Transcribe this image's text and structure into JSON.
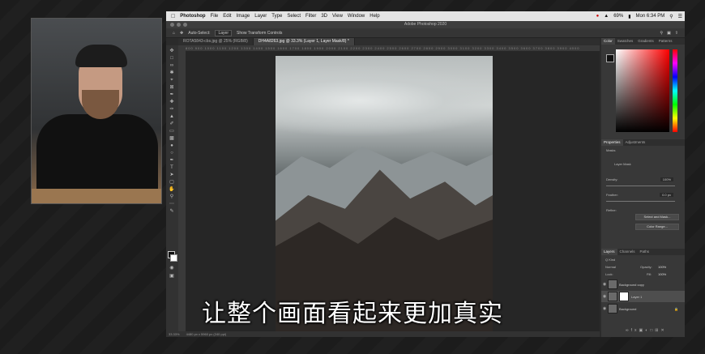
{
  "menubar": {
    "app_name": "Photoshop",
    "items": [
      "File",
      "Edit",
      "Image",
      "Layer",
      "Type",
      "Select",
      "Filter",
      "3D",
      "View",
      "Window",
      "Help"
    ],
    "battery": "69%",
    "clock": "Mon 6:34 PM"
  },
  "window": {
    "title": "Adobe Photoshop 2020"
  },
  "options_bar": {
    "auto_select_label": "Auto-Select:",
    "auto_select_value": "Layer",
    "show_transform": "Show Transform Controls"
  },
  "document_tabs": [
    {
      "label": "ROTA5843-cbs.jpg @ 25% (RGB/8)",
      "active": false
    },
    {
      "label": "DH4A8263.jpg @ 33.3% (Layer 1, Layer Mask/8) *",
      "active": true
    }
  ],
  "ruler_ticks": "800 900 1000 1100 1200 1300 1400 1500 1600 1700 1800 1900 2000 2100 2200 2300 2400 2500 2600 2700 2800 2900 3000 3100 3200 3300 3400 3500 3600 3700 3800 3900 4000",
  "status": {
    "zoom": "33.33%",
    "doc_size": "4480 px x 5960 px (240 ppi)"
  },
  "color_panel": {
    "tabs": [
      "Color",
      "Swatches",
      "Gradients",
      "Patterns"
    ]
  },
  "properties_panel": {
    "tabs": [
      "Properties",
      "Adjustments"
    ],
    "masks_label": "Masks",
    "layer_mask_label": "Layer Mask",
    "density_label": "Density:",
    "density_value": "100%",
    "feather_label": "Feather:",
    "feather_value": "0.0 px",
    "refine_label": "Refine:",
    "select_mask_button": "Select and Mask...",
    "color_range_button": "Color Range..."
  },
  "layers_panel": {
    "tabs": [
      "Layers",
      "Channels",
      "Paths"
    ],
    "kind_label": "Q Kind",
    "blend_mode": "Normal",
    "opacity_label": "Opacity:",
    "opacity_value": "100%",
    "lock_label": "Lock:",
    "fill_label": "Fill:",
    "fill_value": "100%",
    "layers": [
      {
        "name": "Background copy",
        "selected": false,
        "has_mask": false
      },
      {
        "name": "Layer 1",
        "selected": true,
        "has_mask": true
      },
      {
        "name": "Background",
        "selected": false,
        "has_mask": false
      }
    ]
  },
  "subtitle": "让整个画面看起来更加真实"
}
